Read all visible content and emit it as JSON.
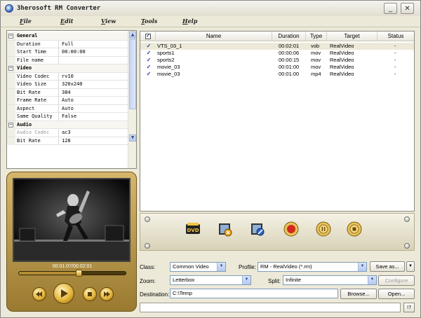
{
  "window": {
    "title": "3herosoft RM Converter"
  },
  "titlebar": {
    "minimize_glyph": "_",
    "close_glyph": "✕"
  },
  "menu": [
    "File",
    "Edit",
    "View",
    "Tools",
    "Help"
  ],
  "properties": [
    {
      "type": "category",
      "label": "General"
    },
    {
      "type": "prop",
      "key": "Duration",
      "value": "Full"
    },
    {
      "type": "prop",
      "key": "Start Time",
      "value": "00:00:00"
    },
    {
      "type": "prop",
      "key": "File name",
      "value": ""
    },
    {
      "type": "category",
      "label": "Video"
    },
    {
      "type": "prop",
      "key": "Video Codec",
      "value": "rv10"
    },
    {
      "type": "prop",
      "key": "Video Size",
      "value": "320x240"
    },
    {
      "type": "prop",
      "key": "Bit Rate",
      "value": "384"
    },
    {
      "type": "prop",
      "key": "Frame Rate",
      "value": "Auto"
    },
    {
      "type": "prop",
      "key": "Aspect",
      "value": "Auto"
    },
    {
      "type": "prop",
      "key": "Same Quality",
      "value": "False"
    },
    {
      "type": "category",
      "label": "Audio"
    },
    {
      "type": "prop",
      "key": "Audio Codec",
      "value": "ac3",
      "disabled": true
    },
    {
      "type": "prop",
      "key": "Bit Rate",
      "value": "128"
    }
  ],
  "player": {
    "time": "00:01:07/00:02:01",
    "progress_fraction": 0.55
  },
  "table": {
    "columns": [
      "Name",
      "Duration",
      "Type",
      "Target",
      "Status"
    ],
    "rows": [
      {
        "name": "VTS_03_1",
        "duration": "00:02:01",
        "type": "vob",
        "target": "RealVideo",
        "status": "-"
      },
      {
        "name": "sports1",
        "duration": "00:00:06",
        "type": "mov",
        "target": "RealVideo",
        "status": "-"
      },
      {
        "name": "sports2",
        "duration": "00:00:15",
        "type": "mov",
        "target": "RealVideo",
        "status": "-"
      },
      {
        "name": "movie_03",
        "duration": "00:01:00",
        "type": "mov",
        "target": "RealVideo",
        "status": "-"
      },
      {
        "name": "movie_03",
        "duration": "00:01:00",
        "type": "mp4",
        "target": "RealVideo",
        "status": "-"
      }
    ]
  },
  "toolbar": [
    "add-dvd-icon",
    "add-video-icon",
    "remove-icon",
    "record-icon",
    "pause-icon",
    "stop-icon"
  ],
  "form": {
    "class_label": "Class:",
    "class_value": "Common Video",
    "profile_label": "Profile:",
    "profile_value": "RM - RealVideo  (*.rm)",
    "save_as": "Save as...",
    "zoom_label": "Zoom:",
    "zoom_value": "Letterbox",
    "split_label": "Split:",
    "split_value": "Infinite",
    "configure": "Configure",
    "destination_label": "Destination:",
    "destination_value": "C:\\Temp",
    "browse": "Browse...",
    "open": "Open..."
  },
  "help_label": "!?"
}
